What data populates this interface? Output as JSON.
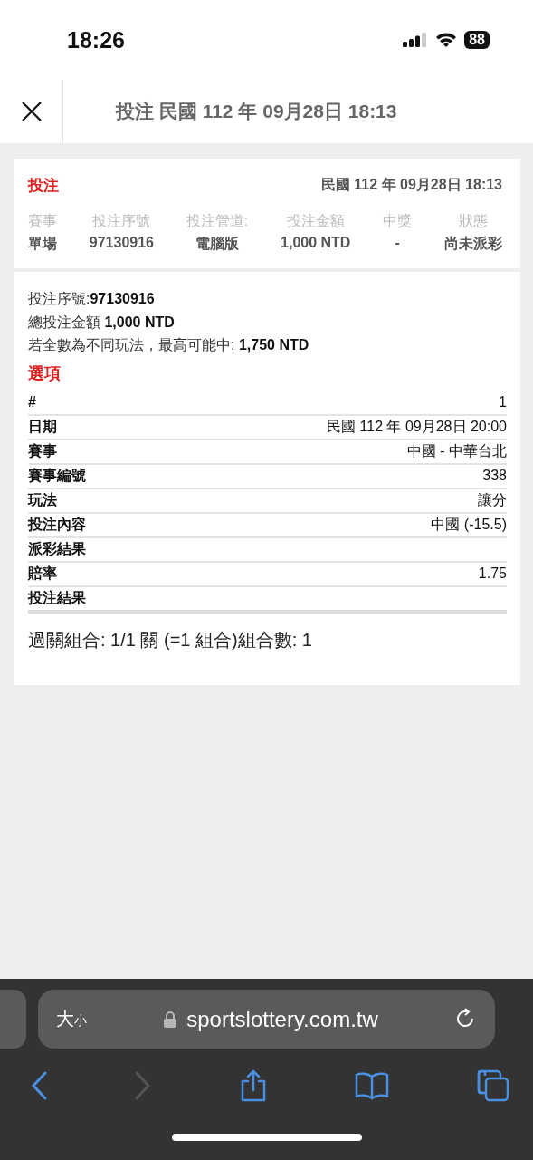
{
  "status_bar": {
    "time": "18:26",
    "battery": "88"
  },
  "header": {
    "title": "投注 民國 112 年 09月28日 18:13"
  },
  "summary": {
    "heading": "投注",
    "datetime": "民國 112 年 09月28日 18:13",
    "columns": [
      {
        "label": "賽事",
        "value": "單場"
      },
      {
        "label": "投注序號",
        "value": "97130916"
      },
      {
        "label": "投注管道:",
        "value": "電腦版"
      },
      {
        "label": "投注金額",
        "value": "1,000 NTD"
      },
      {
        "label": "中獎",
        "value": "-"
      },
      {
        "label": "狀態",
        "value": "尚未派彩"
      }
    ]
  },
  "details": {
    "lines": [
      "投注序號:**97130916**",
      "總投注金額 **1,000 NTD**",
      "若全數為不同玩法，最高可能中: **1,750 NTD**"
    ],
    "options_heading": "選項",
    "rows": [
      {
        "label": "#",
        "value": "1"
      },
      {
        "label": "日期",
        "value": "民國 112 年 09月28日 20:00"
      },
      {
        "label": "賽事",
        "value": "中國 - 中華台北"
      },
      {
        "label": "賽事編號",
        "value": "338"
      },
      {
        "label": "玩法",
        "value": "讓分"
      },
      {
        "label": "投注內容",
        "value": "中國 (-15.5)"
      },
      {
        "label": "派彩結果"
      },
      {
        "label": "賠率",
        "value": "1.75"
      },
      {
        "label": "投注結果"
      }
    ],
    "combination": "過關組合: 1/1 關 (=1 組合)組合數: 1"
  },
  "browser": {
    "text_size": {
      "large": "大",
      "small": "小"
    },
    "url": "sportslottery.com.tw",
    "toolbar": [
      {
        "kind": "back",
        "disabled": false
      },
      {
        "kind": "forward",
        "disabled": true
      },
      {
        "kind": "share",
        "disabled": false
      },
      {
        "kind": "bookmarks",
        "disabled": false
      },
      {
        "kind": "tabs",
        "disabled": false
      }
    ]
  }
}
